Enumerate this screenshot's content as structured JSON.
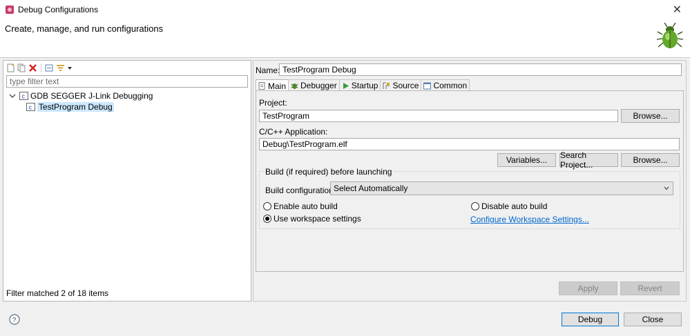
{
  "window": {
    "title": "Debug Configurations",
    "close_glyph": "✕"
  },
  "header": {
    "heading": "Create, manage, and run configurations",
    "image": "bug-icon"
  },
  "left": {
    "filter_placeholder": "type filter text",
    "tree": [
      {
        "label": "GDB SEGGER J-Link Debugging",
        "expanded": true
      },
      {
        "label": "TestProgram Debug",
        "selected": true
      }
    ],
    "status": "Filter matched 2 of 18 items"
  },
  "right": {
    "name_label": "Name:",
    "name_value": "TestProgram Debug",
    "tabs": [
      {
        "label": "Main",
        "icon": "main-tab-icon",
        "active": true
      },
      {
        "label": "Debugger",
        "icon": "debugger-tab-icon"
      },
      {
        "label": "Startup",
        "icon": "startup-tab-icon"
      },
      {
        "label": "Source",
        "icon": "source-tab-icon"
      },
      {
        "label": "Common",
        "icon": "common-tab-icon"
      }
    ],
    "main": {
      "project_label": "Project:",
      "project_value": "TestProgram",
      "browse_label": "Browse...",
      "app_label": "C/C++ Application:",
      "app_value": "Debug\\TestProgram.elf",
      "variables_label": "Variables...",
      "search_project_label": "Search Project...",
      "browse2_label": "Browse...",
      "build_group_title": "Build (if required) before launching",
      "build_config_label": "Build configuration:",
      "build_config_value": "Select Automatically",
      "radio_enable": "Enable auto build",
      "radio_disable": "Disable auto build",
      "radio_workspace": "Use workspace settings",
      "configure_link": "Configure Workspace Settings..."
    },
    "apply_label": "Apply",
    "revert_label": "Revert"
  },
  "footer": {
    "debug_label": "Debug",
    "close_label": "Close"
  }
}
